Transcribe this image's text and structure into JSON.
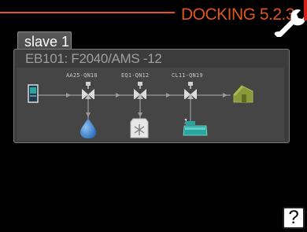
{
  "header": {
    "title": "DOCKING 5.2.3"
  },
  "tab": {
    "label": "slave 1"
  },
  "panel": {
    "device_label": "EB101:  F2040/AMS -12"
  },
  "components": [
    {
      "label": "AA25-QN10"
    },
    {
      "label": "EQ1-QN12"
    },
    {
      "label": "CL11-QN19"
    }
  ],
  "colors": {
    "accent": "#e1571b",
    "water": "#3a7fcf",
    "pool": "#2aa6a0",
    "heatpump": "#8a9a3a"
  },
  "pool_index": "1",
  "help": {
    "symbol": "?"
  }
}
